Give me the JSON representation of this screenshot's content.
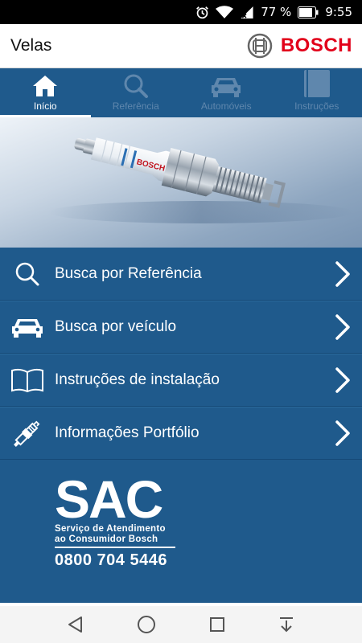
{
  "status_bar": {
    "battery_percent": "77 %",
    "time": "9:55"
  },
  "app_bar": {
    "title": "Velas",
    "brand": "BOSCH"
  },
  "tabs": [
    {
      "label": "Início",
      "icon": "home-icon",
      "active": true
    },
    {
      "label": "Referência",
      "icon": "search-icon",
      "active": false
    },
    {
      "label": "Automóveis",
      "icon": "car-icon",
      "active": false
    },
    {
      "label": "Instruções",
      "icon": "book-icon",
      "active": false
    }
  ],
  "hero": {
    "image": "spark-plug-photo"
  },
  "menu": [
    {
      "label": "Busca por Referência",
      "icon": "search-icon"
    },
    {
      "label": "Busca por veículo",
      "icon": "car-icon"
    },
    {
      "label": "Instruções de instalação",
      "icon": "open-book-icon"
    },
    {
      "label": "Informações Portfólio",
      "icon": "spark-plug-icon"
    }
  ],
  "sac": {
    "title": "SAC",
    "line1": "Serviço de Atendimento",
    "line2": "ao  Consumidor  Bosch",
    "phone": "0800 704 5446"
  },
  "colors": {
    "primary": "#1f5a8c",
    "brand_red": "#e2001a",
    "inactive_tab": "#5f87ad"
  }
}
